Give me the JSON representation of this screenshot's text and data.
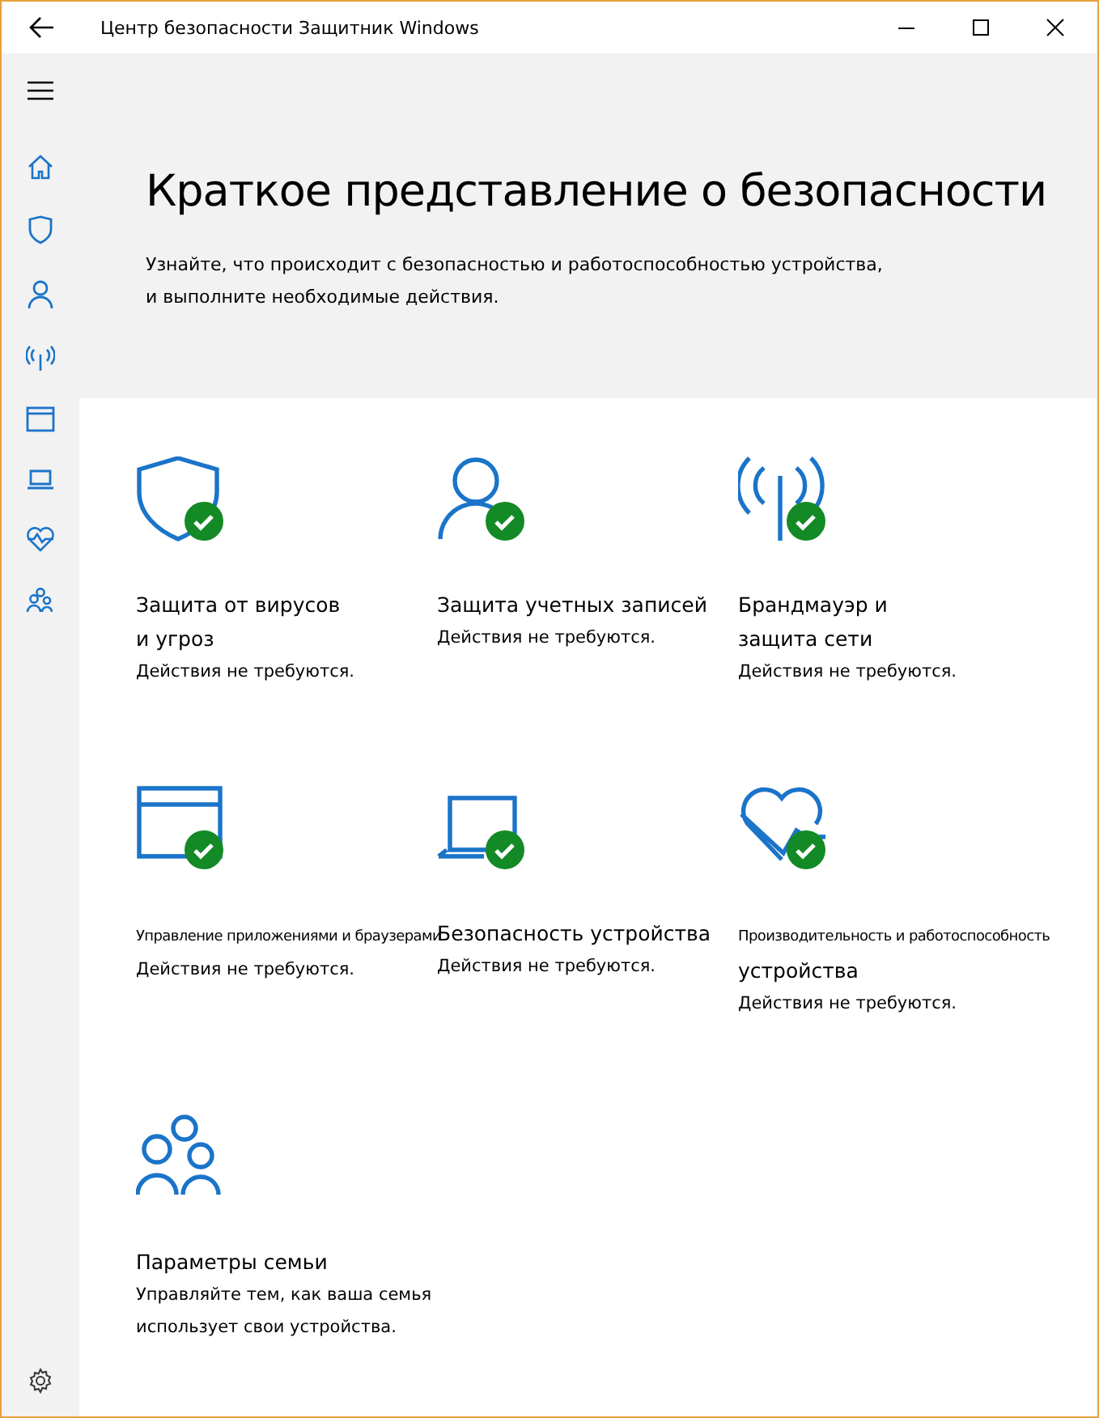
{
  "window": {
    "title": "Центр безопасности Защитник Windows"
  },
  "header": {
    "title": "Краткое представление о безопасности",
    "subtitle": [
      "Узнайте, что происходит с безопасностью и работоспособностью устройства,",
      "и выполните необходимые действия."
    ]
  },
  "tiles": [
    {
      "ok": true,
      "title": [
        {
          "text": "Защита от вирусов",
          "small": false
        },
        {
          "text": "и угроз",
          "small": false
        }
      ],
      "status": [
        "Действия не требуются."
      ]
    },
    {
      "ok": true,
      "title": [
        {
          "text": "Защита учетных записей",
          "small": false
        }
      ],
      "status": [
        "Действия не требуются."
      ]
    },
    {
      "ok": true,
      "title": [
        {
          "text": "Брандмауэр и",
          "small": false
        },
        {
          "text": "защита сети",
          "small": false
        }
      ],
      "status": [
        "Действия не требуются."
      ]
    },
    {
      "ok": true,
      "title": [
        {
          "text": "Управление приложениями и браузерами",
          "small": true
        }
      ],
      "status": [
        "Действия не требуются."
      ]
    },
    {
      "ok": true,
      "title": [
        {
          "text": "Безопасность устройства",
          "small": false
        }
      ],
      "status": [
        "Действия не требуются."
      ]
    },
    {
      "ok": true,
      "title": [
        {
          "text": "Производительность и работоспособность",
          "small": true
        },
        {
          "text": "устройства",
          "small": false
        }
      ],
      "status": [
        "Действия не требуются."
      ]
    },
    {
      "ok": false,
      "title": [
        {
          "text": "Параметры семьи",
          "small": false
        }
      ],
      "status": [
        "Управляйте тем, как ваша семья",
        "использует свои устройства."
      ]
    }
  ]
}
